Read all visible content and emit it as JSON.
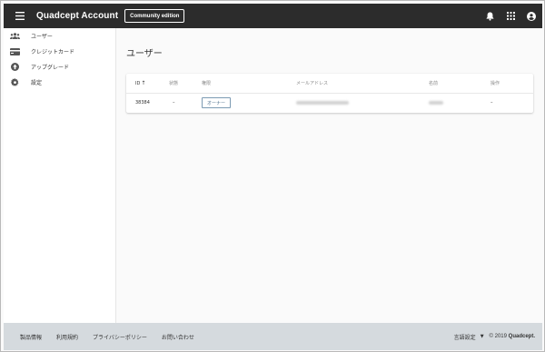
{
  "header": {
    "app_title": "Quadcept Account",
    "edition_badge": "Community edition"
  },
  "sidebar": {
    "items": [
      {
        "label": "ユーザー",
        "icon": "users-icon"
      },
      {
        "label": "クレジットカード",
        "icon": "credit-card-icon"
      },
      {
        "label": "アップグレード",
        "icon": "upgrade-icon"
      },
      {
        "label": "設定",
        "icon": "gear-icon"
      }
    ]
  },
  "main": {
    "title": "ユーザー",
    "table": {
      "headers": {
        "id": "ID",
        "status": "状態",
        "role": "権限",
        "email": "メールアドレス",
        "name": "名前",
        "actions": "操作"
      },
      "rows": [
        {
          "id": "38384",
          "status": "–",
          "role": "オーナー",
          "actions": "–"
        }
      ]
    }
  },
  "footer": {
    "links": [
      "製品情報",
      "利用規約",
      "プライバシーポリシー",
      "お問い合わせ"
    ],
    "language": "言語設定",
    "copyright_prefix": "© 2019",
    "copyright_brand": "Quadcept."
  }
}
